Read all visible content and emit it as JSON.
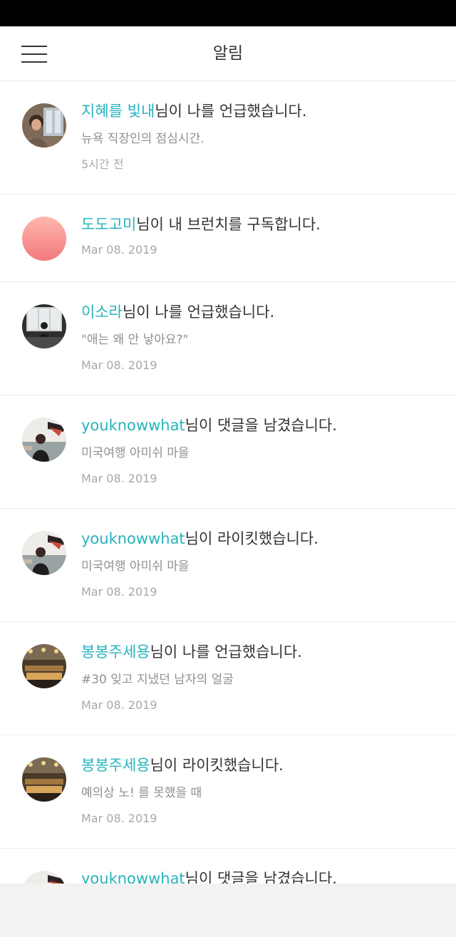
{
  "header": {
    "title": "알림",
    "menu_icon": "hamburger-menu-icon"
  },
  "notifications": [
    {
      "user": "지혜를 빛내",
      "action": "님이 나를 언급했습니다.",
      "excerpt": "뉴욕 직장인의 점심시간.",
      "time": "5시간 전",
      "avatar": "photo"
    },
    {
      "user": "도도고미",
      "action": "님이 내 브런치를 구독합니다.",
      "time": "Mar 08. 2019",
      "avatar": "pink-gradient"
    },
    {
      "user": "이소라",
      "action": "님이 나를 언급했습니다.",
      "excerpt": "\"애는 왜 안 낳아요?\"",
      "time": "Mar 08. 2019",
      "avatar": "photo"
    },
    {
      "user": "youknowwhat",
      "action": "님이 댓글을 남겼습니다.",
      "excerpt": "미국여행 아미쉬 마을",
      "time": "Mar 08. 2019",
      "avatar": "photo"
    },
    {
      "user": "youknowwhat",
      "action": "님이 라이킷했습니다.",
      "excerpt": "미국여행 아미쉬 마을",
      "time": "Mar 08. 2019",
      "avatar": "photo"
    },
    {
      "user": "봉봉주세용",
      "action": "님이 나를 언급했습니다.",
      "excerpt": "#30 잊고 지냈던 남자의 얼굴",
      "time": "Mar 08. 2019",
      "avatar": "photo"
    },
    {
      "user": "봉봉주세용",
      "action": "님이 라이킷했습니다.",
      "excerpt": "예의상 노! 를 못했을 때",
      "time": "Mar 08. 2019",
      "avatar": "photo"
    },
    {
      "user": "youknowwhat",
      "action": "님이 댓글을 남겼습니다.",
      "avatar": "photo"
    }
  ],
  "colors": {
    "accent": "#26b3bd",
    "status_bar": "#000000",
    "bottom_area": "#f2f2f2"
  }
}
